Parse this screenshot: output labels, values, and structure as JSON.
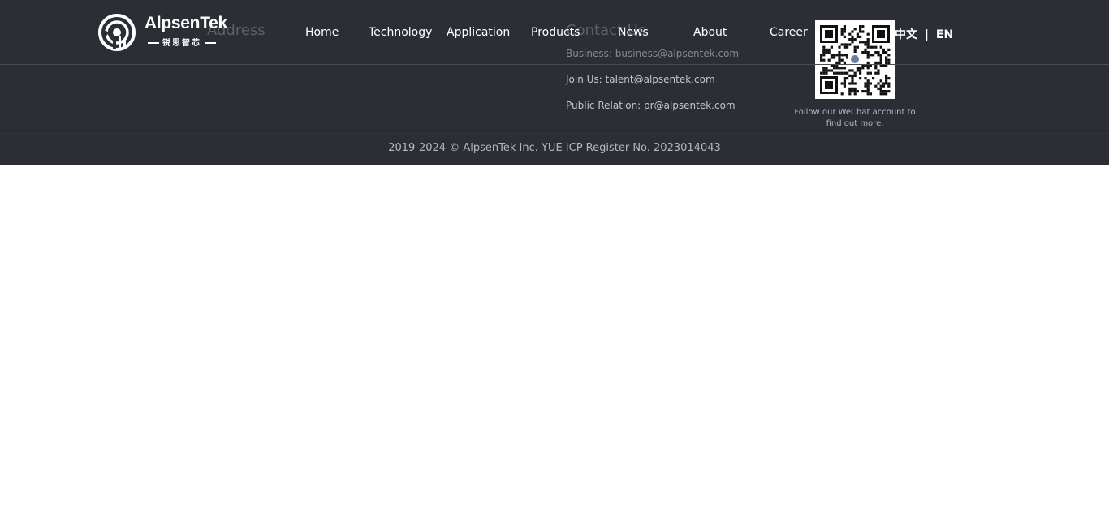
{
  "brand": {
    "name": "AlpsenTek",
    "subtitle": "锐思智芯",
    "logo_icon": "alpsentek-logo-icon"
  },
  "nav": {
    "items": [
      {
        "label": "Home"
      },
      {
        "label": "Technology"
      },
      {
        "label": "Application"
      },
      {
        "label": "Products"
      },
      {
        "label": "News"
      },
      {
        "label": "About"
      },
      {
        "label": "Career"
      }
    ],
    "lang_zh": "中文",
    "lang_sep": "|",
    "lang_en": "EN"
  },
  "footer": {
    "address_title": "Address",
    "contact_title": "Contact Us",
    "business": "Business: business@alpsentek.com",
    "join": "Join Us: talent@alpsentek.com",
    "pr": "Public Relation: pr@alpsentek.com",
    "qr_icon": "wechat-qr-code",
    "qr_caption": "Follow our WeChat account to find out more.",
    "copyright": "2019-2024 © AlpsenTek Inc. YUE ICP Register No. 2023014043"
  },
  "colors": {
    "footer_bg": "#2c2e35",
    "text_light": "#ffffff",
    "text_muted": "#b5b8be"
  }
}
